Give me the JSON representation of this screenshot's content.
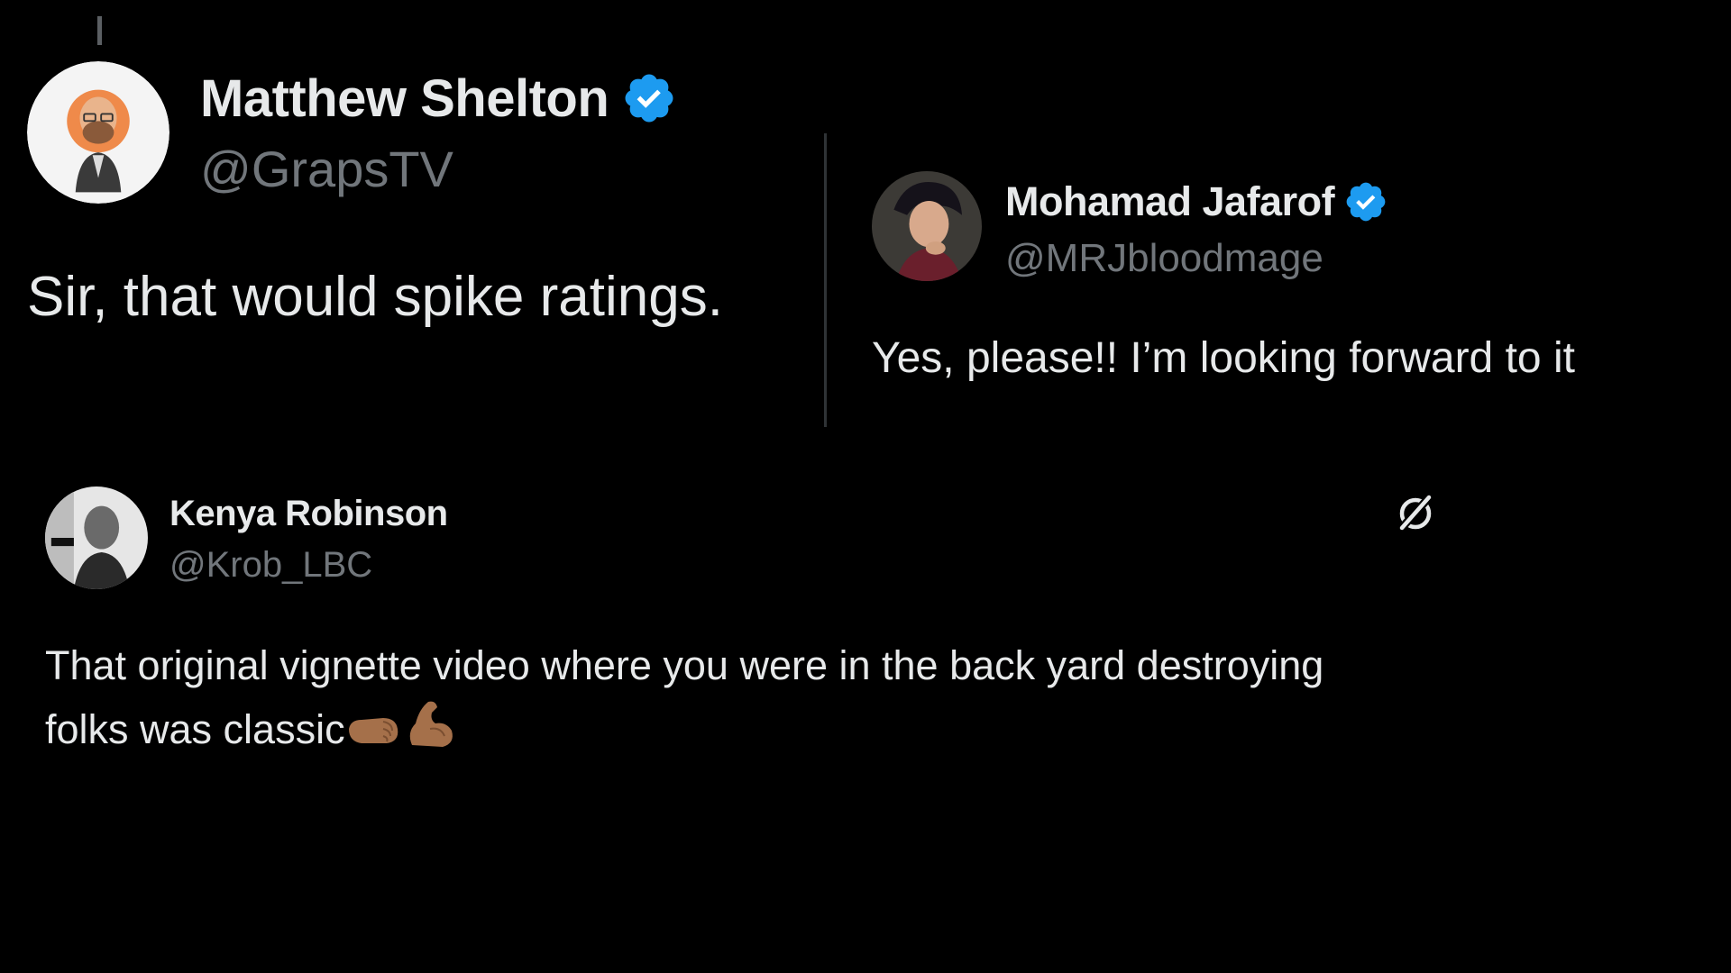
{
  "posts": [
    {
      "name": "Matthew Shelton",
      "handle": "@GrapsTV",
      "verified": true,
      "text": "Sir, that would spike ratings."
    },
    {
      "name": "Mohamad Jafarof",
      "handle": "@MRJbloodmage",
      "verified": true,
      "text": "Yes, please!! I’m looking forward to it"
    },
    {
      "name": "Kenya Robinson",
      "handle": "@Krob_LBC",
      "verified": false,
      "text_line1": "That original vignette video where you were in the back yard destroying",
      "text_line2": "folks was classic",
      "emojis": [
        "left-facing-fist-medium-dark-skin",
        "flexed-biceps-medium-dark-skin"
      ]
    }
  ],
  "colors": {
    "background": "#000000",
    "primary_text": "#e7e9ea",
    "secondary_text": "#71767b",
    "verified_blue": "#1d9bf0",
    "divider": "#2f3336"
  },
  "icons": {
    "verified": "verified-badge-icon",
    "grok": "grok-icon"
  }
}
